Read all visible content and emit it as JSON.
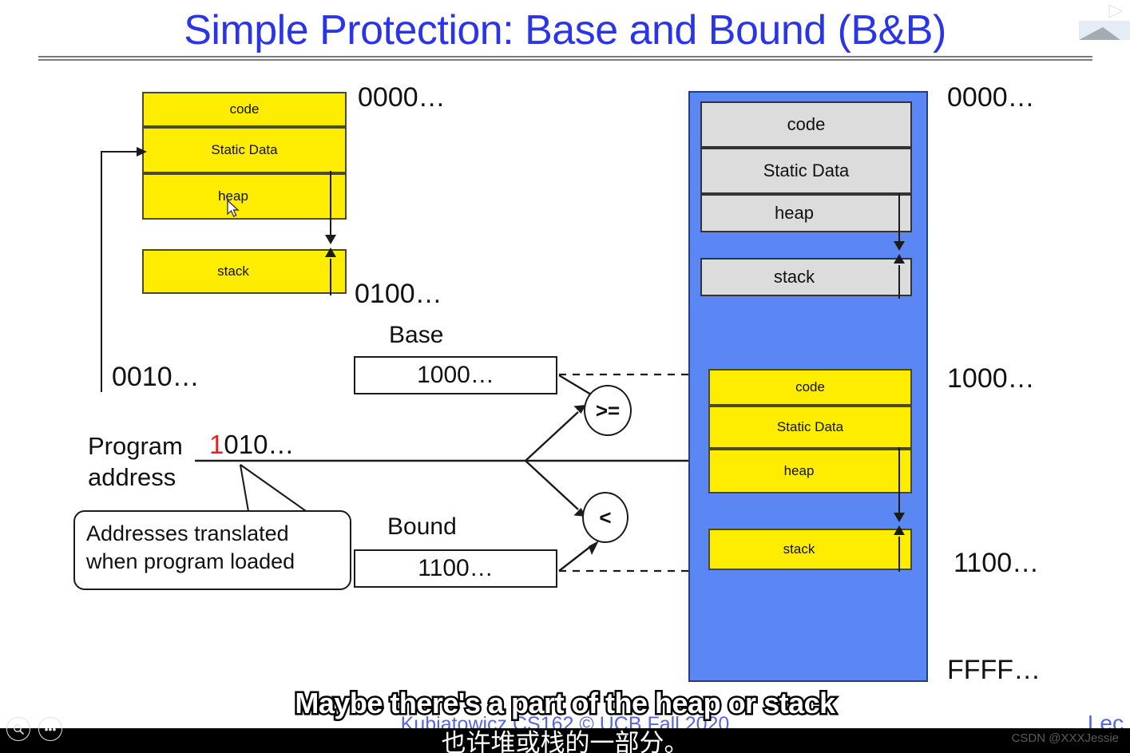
{
  "slide": {
    "title": "Simple Protection: Base and Bound (B&B)",
    "footer_credit": "Kubiatowicz CS162 © UCB Fall 2020",
    "lec_label": "Lec"
  },
  "virtual_memory": {
    "label_top": "0000…",
    "label_bottom": "0100…",
    "segments": [
      {
        "name": "code"
      },
      {
        "name": "Static Data"
      },
      {
        "name": "heap"
      },
      {
        "name": "stack"
      }
    ]
  },
  "physical_memory": {
    "labels": {
      "top": "0000…",
      "base": "1000…",
      "bound": "1100…",
      "end": "FFFF…"
    },
    "upper_program": [
      {
        "name": "code"
      },
      {
        "name": "Static Data"
      },
      {
        "name": "heap"
      },
      {
        "name": "stack"
      }
    ],
    "lower_program": [
      {
        "name": "code"
      },
      {
        "name": "Static Data"
      },
      {
        "name": "heap"
      },
      {
        "name": "stack"
      }
    ]
  },
  "registers": {
    "base": {
      "caption": "Base",
      "value": "1000…"
    },
    "bound": {
      "caption": "Bound",
      "value": "1100…"
    }
  },
  "comparators": {
    "ge": ">=",
    "lt": "<"
  },
  "program_address": {
    "label_line1": "Program",
    "label_line2": "address",
    "value_prefix": "1",
    "value_rest": "010…",
    "offset_label": "0010…"
  },
  "callout": {
    "line1": "Addresses translated",
    "line2": "when program loaded"
  },
  "captions": {
    "english": "Maybe there's a part of the heap or stack",
    "chinese": "也许堆或栈的一部分。"
  },
  "watermark": "CSDN @XXXJessie",
  "controls": {
    "search": "⚲",
    "more": "•••"
  },
  "colors": {
    "title_blue": "#2a35e8",
    "yellow": "#ffed00",
    "blue_memory": "#5b87f5",
    "grey_block": "#dcdcdc",
    "red_bit": "#e8231b"
  }
}
